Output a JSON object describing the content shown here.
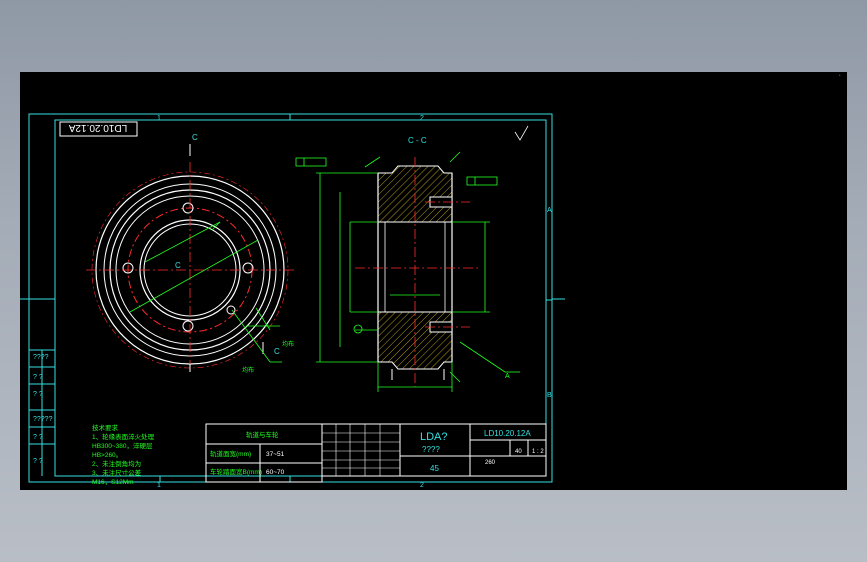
{
  "drawing": {
    "code_box": "LD10.20.12A",
    "section_label": "C - C",
    "view_label": "C",
    "zone_top": [
      "1",
      "2"
    ],
    "zone_right": [
      "A",
      "B"
    ],
    "zone_bottom": [
      "1",
      "2"
    ],
    "left_marks": [
      "????",
      "? ?",
      "? ?",
      "?????",
      "? ?",
      "? ?"
    ],
    "hole_note": "均布",
    "hole_note2": "均布",
    "tech_title": "技术要求",
    "tech_lines": [
      "1、轮缘表面淬火处理",
      "HB300~380，淬硬层",
      "HB>260。",
      "2、未注倒角均为",
      "3、未注尺寸公差",
      "M16，S12Mm"
    ],
    "rail_title": "轨道与车轮",
    "rail_row1_label": "轨道面宽(mm)",
    "rail_row1_value": "37~51",
    "rail_row2_label": "车轮踏面宽B(mm)",
    "rail_row2_value": "60~70",
    "title_name": "LDA?",
    "title_sub": "????",
    "material": "45",
    "drawing_no": "LD10.20.12A",
    "scale": "1 : 2",
    "quantity": "40",
    "weight": "260"
  },
  "colors": {
    "background": "#000000",
    "frame": "#33e0e0",
    "outline": "#ffffff",
    "center": "#ff2a2a",
    "dimension": "#22ff22",
    "hatch": "#e0c020",
    "accent": "#ff40ff"
  }
}
